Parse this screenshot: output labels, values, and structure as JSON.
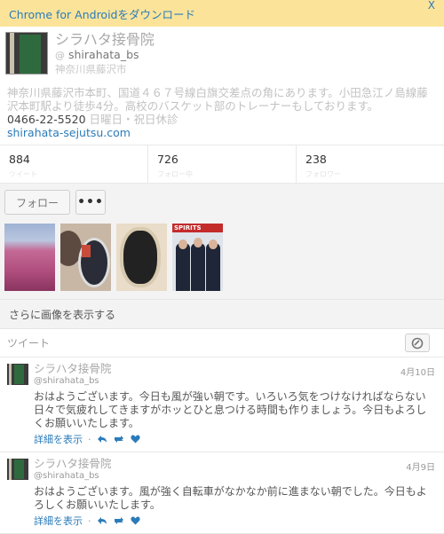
{
  "banner": {
    "text": "Chrome for Androidをダウンロード",
    "close": "X"
  },
  "profile": {
    "name": "シラハタ接骨院",
    "handle": "shirahata_bs",
    "at": "@",
    "location": "神奈川県藤沢市",
    "bio": "神奈川県藤沢市本町、国道４６７号線白旗交差点の角にあります。小田急江ノ島線藤沢本町駅より徒歩4分。高校のバスケット部のトレーナーもしております。",
    "phone": "0466-22-5520",
    "hours": "日曜日・祝日休診",
    "link": "shirahata-sejutsu.com"
  },
  "stats": [
    {
      "num": "884",
      "label": "ツイート"
    },
    {
      "num": "726",
      "label": "フォロー中"
    },
    {
      "num": "238",
      "label": "フォロワー"
    }
  ],
  "actions": {
    "follow": "フォロー",
    "more": "•••"
  },
  "photos": {
    "poster_text": "SPIRITS"
  },
  "more_images": "さらに画像を表示する",
  "tweets_header": "ツイート",
  "tweets": [
    {
      "name": "シラハタ接骨院",
      "handle": "@shirahata_bs",
      "date": "4月10日",
      "text": "おはようございます。今日も風が強い朝です。いろいろ気をつけなければならない日々で気疲れしてきますがホッとひと息つける時間も作りましょう。今日もよろしくお願いいたします。",
      "details": "詳細を表示"
    },
    {
      "name": "シラハタ接骨院",
      "handle": "@shirahata_bs",
      "date": "4月9日",
      "text": "おはようございます。風が強く自転車がなかなか前に進まない朝でした。今日もよろしくお願いいたします。",
      "details": "詳細を表示"
    }
  ]
}
